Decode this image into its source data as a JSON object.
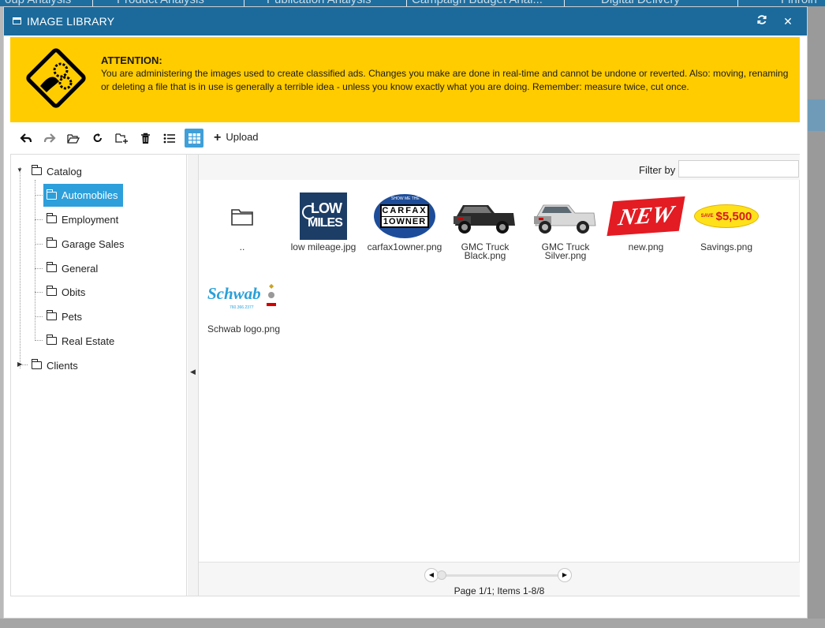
{
  "background_tabs": [
    "oup Analysis",
    "Product Analysis",
    "Publication Analysis",
    "Campaign Budget Anal...",
    "Digital Delivery",
    "Finroin"
  ],
  "window": {
    "title": "IMAGE LIBRARY",
    "refresh_icon": "refresh-icon",
    "close_icon": "close-icon"
  },
  "attention": {
    "heading": "ATTENTION:",
    "body": "You are administering the images used to create classified ads. Changes you make are done in real-time and cannot be undone or reverted. Also: moving, renaming or deleting a file that is in use is generally a terrible idea - unless you know exactly what you are doing. Remember: measure twice, cut once."
  },
  "toolbar": {
    "upload_label": "Upload",
    "active_view": "grid"
  },
  "tree": {
    "root": "Catalog",
    "children": [
      "Automobiles",
      "Employment",
      "Garage Sales",
      "General",
      "Obits",
      "Pets",
      "Real Estate"
    ],
    "selected": "Automobiles",
    "other_root": "Clients"
  },
  "filter": {
    "label": "Filter by",
    "value": ""
  },
  "files": [
    {
      "name": "..",
      "type": "folder"
    },
    {
      "name": "low mileage.jpg",
      "thumb_text": [
        "LOW",
        "MILES"
      ]
    },
    {
      "name": "carfax1owner.png",
      "thumb_text": [
        "SHOW ME THE",
        "CARFAX",
        "1OWNER"
      ]
    },
    {
      "name": "GMC Truck Black.png"
    },
    {
      "name": "GMC Truck Silver.png"
    },
    {
      "name": "new.png",
      "thumb_text": [
        "NEW"
      ]
    },
    {
      "name": "Savings.png",
      "thumb_text": [
        "SAVE",
        "$5,500"
      ]
    },
    {
      "name": "Schwab logo.png",
      "thumb_text": [
        "Schwab",
        "760.366.2377"
      ]
    }
  ],
  "pager": {
    "status": "Page 1/1; Items 1-8/8"
  },
  "colors": {
    "titlebar": "#1b6a9b",
    "attention": "#ffcc00",
    "selected": "#2d9fdb"
  }
}
